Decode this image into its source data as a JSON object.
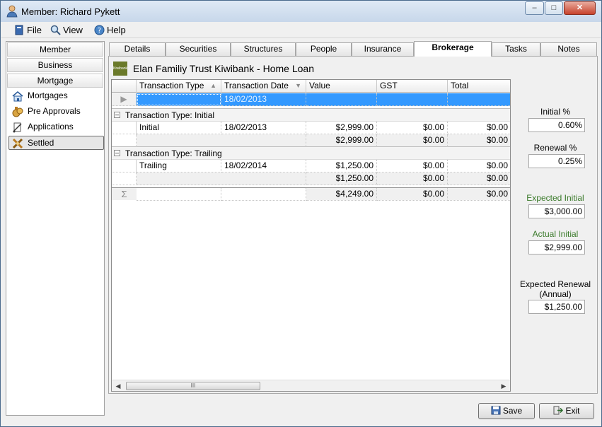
{
  "window": {
    "title": "Member: Richard Pykett",
    "minimize": "–",
    "maximize": "□",
    "close": "✕"
  },
  "menu": [
    {
      "label": "File",
      "icon": "file-icon"
    },
    {
      "label": "View",
      "icon": "view-icon"
    },
    {
      "label": "Help",
      "icon": "help-icon"
    }
  ],
  "sidebar": {
    "categories": [
      "Member",
      "Business",
      "Mortgage"
    ],
    "items": [
      {
        "label": "Mortgages",
        "icon": "house-icon"
      },
      {
        "label": "Pre Approvals",
        "icon": "money-bag-icon"
      },
      {
        "label": "Applications",
        "icon": "applications-icon"
      },
      {
        "label": "Settled",
        "icon": "settled-icon",
        "active": true
      }
    ]
  },
  "tabs": [
    "Details",
    "Securities",
    "Structures",
    "People",
    "Insurance",
    "Brokerage",
    "Tasks",
    "Notes"
  ],
  "active_tab": "Brokerage",
  "loan": {
    "logo_text": "Kiwibank",
    "title": "Elan Familiy Trust Kiwibank - Home Loan"
  },
  "grid": {
    "columns": [
      "Transaction Type",
      "Transaction Date",
      "Value",
      "GST",
      "Total"
    ],
    "new_row": {
      "date": "18/02/2013"
    },
    "groups": [
      {
        "header": "Transaction Type:  Initial",
        "rows": [
          {
            "type": "Initial",
            "date": "18/02/2013",
            "value": "$2,999.00",
            "gst": "$0.00",
            "total": "$0.00"
          }
        ],
        "summary": {
          "value": "$2,999.00",
          "gst": "$0.00",
          "total": "$0.00"
        }
      },
      {
        "header": "Transaction Type:  Trailing",
        "rows": [
          {
            "type": "Trailing",
            "date": "18/02/2014",
            "value": "$1,250.00",
            "gst": "$0.00",
            "total": "$0.00"
          }
        ],
        "summary": {
          "value": "$1,250.00",
          "gst": "$0.00",
          "total": "$0.00"
        }
      }
    ],
    "totals": {
      "sigma": "Σ",
      "value": "$4,249.00",
      "gst": "$0.00",
      "total": "$0.00"
    },
    "scroll_left": "◀",
    "scroll_right": "▶",
    "scroll_grip": "III"
  },
  "rates": {
    "initial_label": "Initial %",
    "initial_value": "0.60%",
    "renewal_label": "Renewal %",
    "renewal_value": "0.25%",
    "expected_initial_label": "Expected Initial",
    "expected_initial_value": "$3,000.00",
    "actual_initial_label": "Actual Initial",
    "actual_initial_value": "$2,999.00",
    "expected_renewal_label": "Expected Renewal (Annual)",
    "expected_renewal_value": "$1,250.00"
  },
  "buttons": {
    "save": "Save",
    "exit": "Exit"
  },
  "colors": {
    "selection": "#3399ff",
    "green_label": "#3a7a2a"
  }
}
